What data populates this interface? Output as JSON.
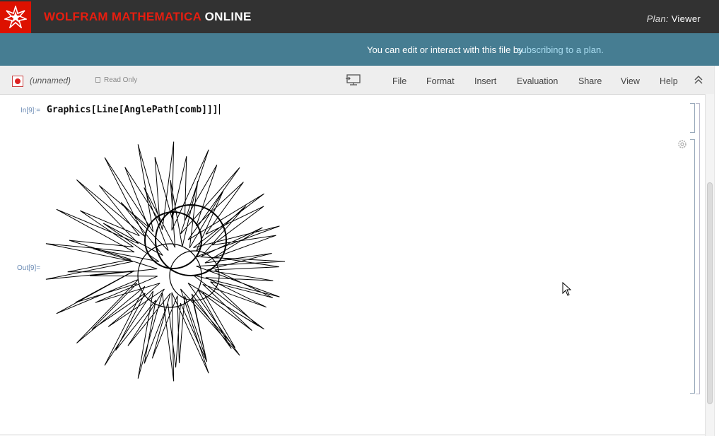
{
  "header": {
    "brand_red": "WOLFRAM MATHEMATICA",
    "brand_white": "ONLINE",
    "plan_label": "Plan:",
    "plan_value": "Viewer",
    "logo_icon": "wolfram-spikey-icon"
  },
  "banner": {
    "text": "You can edit or interact with this file by",
    "link": "subscribing to a plan."
  },
  "toolbar": {
    "notebook_name": "(unnamed)",
    "read_only": "Read Only",
    "menu": [
      "File",
      "Format",
      "Insert",
      "Evaluation",
      "Share",
      "View",
      "Help"
    ]
  },
  "notebook": {
    "in_label": "In[9]:=",
    "input": "Graphics[Line[AnglePath[comb]]]",
    "out_label": "Out[9]="
  },
  "colors": {
    "topbar": "#323232",
    "brand_red": "#e61e10",
    "banner": "#467d92",
    "link": "#a9dcf0"
  }
}
